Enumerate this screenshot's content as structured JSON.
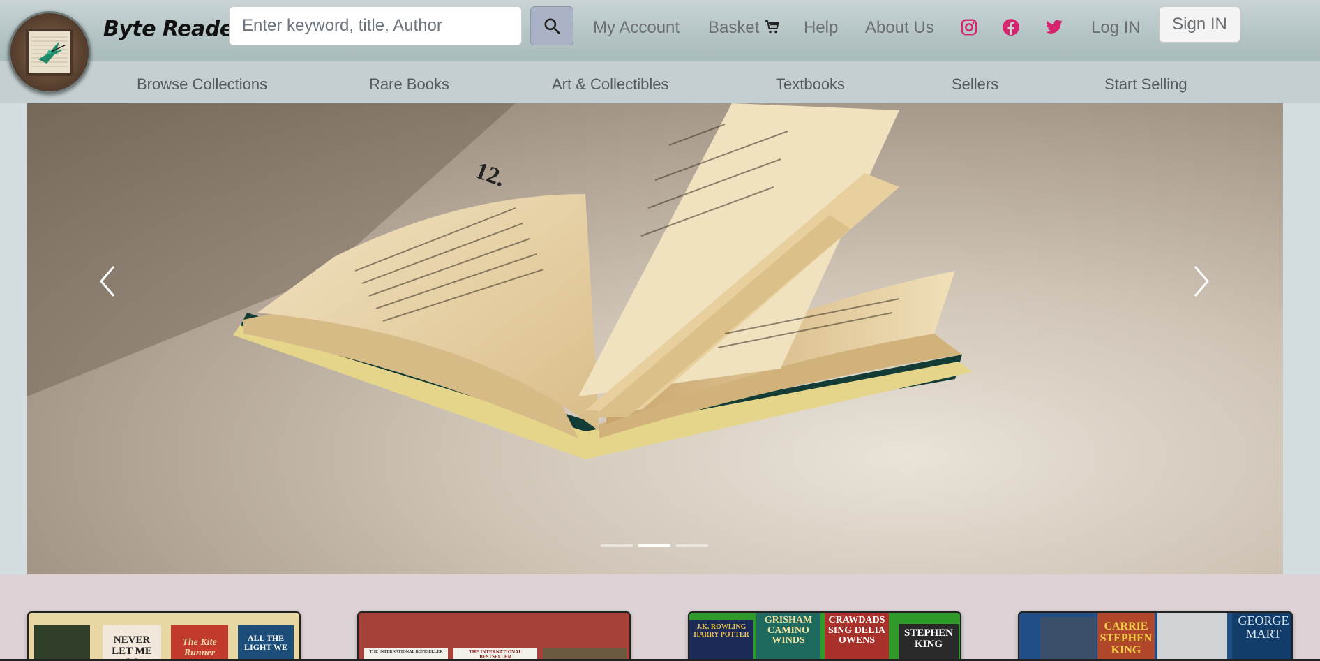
{
  "header": {
    "brand": "Byte Reader",
    "search": {
      "placeholder": "Enter keyword, title, Author",
      "value": ""
    },
    "links": {
      "my_account": "My Account",
      "basket": "Basket",
      "help": "Help",
      "about_us": "About Us",
      "log_in": "Log IN"
    },
    "sign_in": "Sign IN",
    "social_color": "#d6246e"
  },
  "subnav": {
    "items": [
      "Browse Collections",
      "Rare Books",
      "Art & Collectibles",
      "Textbooks",
      "Sellers",
      "Start Selling"
    ]
  },
  "carousel": {
    "slide_count": 3,
    "active_index": 1
  },
  "bottom_cards": [
    {
      "covers": [
        {
          "title": "",
          "bg": "#2f3f2a"
        },
        {
          "title": "NEVER LET ME GO",
          "bg": "#f1e7da"
        },
        {
          "title": "The Kite Runner",
          "bg": "#c23a2b"
        },
        {
          "title": "ALL THE LIGHT WE",
          "bg": "#1d4e7a"
        }
      ],
      "bg": "#e8d7a2"
    },
    {
      "covers": [
        {
          "title": "THE INTERNATIONAL BESTSELLER",
          "bg": "#f3f0ea"
        },
        {
          "title": "THE INTERNATIONAL BESTSELLER",
          "bg": "#f3f0ea"
        },
        {
          "title": "",
          "bg": "#6c5a3e"
        }
      ],
      "bg": "#a5403a"
    },
    {
      "covers": [
        {
          "title": "J.K. ROWLING HARRY POTTER",
          "bg": "#1b2a57"
        },
        {
          "title": "GRISHAM CAMINO WINDS",
          "bg": "#1e6a5f"
        },
        {
          "title": "CRAWDADS SING DELIA OWENS",
          "bg": "#a9312b"
        },
        {
          "title": "STEPHEN KING",
          "bg": "#2a2a2a"
        }
      ],
      "bg": "#2f9a2a"
    },
    {
      "covers": [
        {
          "title": "",
          "bg": "#3b4f6b"
        },
        {
          "title": "CARRIE STEPHEN KING",
          "bg": "#b0472a"
        },
        {
          "title": "",
          "bg": "#cfd3d6"
        },
        {
          "title": "GEORGE MART",
          "bg": "#123d6a"
        }
      ],
      "bg": "#1f4f86"
    }
  ]
}
